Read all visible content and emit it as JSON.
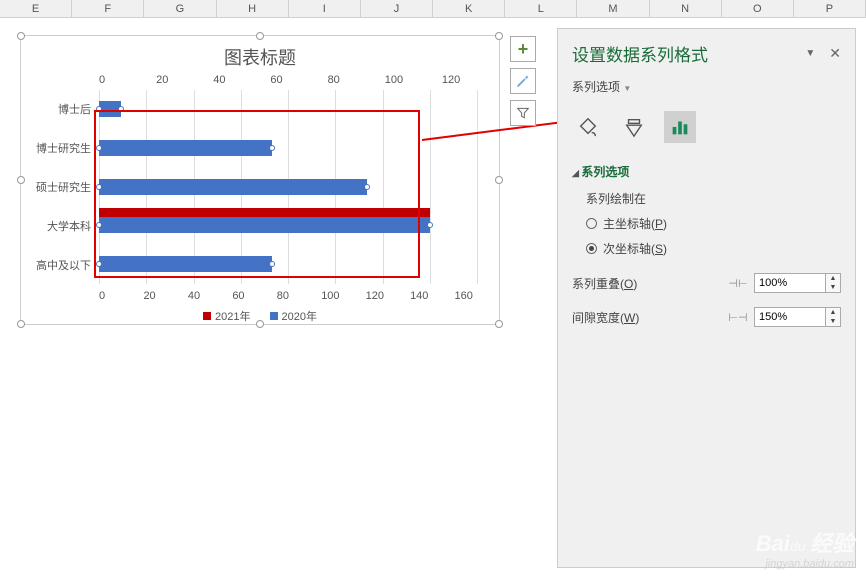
{
  "columns": [
    "E",
    "F",
    "G",
    "H",
    "I",
    "J",
    "K",
    "L",
    "M",
    "N",
    "O",
    "P"
  ],
  "chart": {
    "title": "图表标题",
    "legend_2021": "2021年",
    "legend_2020": "2020年"
  },
  "chart_data": {
    "type": "bar",
    "orientation": "horizontal",
    "categories": [
      "博士后",
      "博士研究生",
      "硕士研究生",
      "大学本科",
      "高中及以下"
    ],
    "series": [
      {
        "name": "2021年",
        "values": [
          null,
          null,
          null,
          140,
          null
        ],
        "axis": "primary",
        "color": "#c00000"
      },
      {
        "name": "2020年",
        "values": [
          7,
          55,
          85,
          105,
          55
        ],
        "axis": "secondary",
        "color": "#4472c4"
      }
    ],
    "primary_axis": {
      "position": "bottom",
      "min": 0,
      "max": 160,
      "step": 20,
      "ticks": [
        "0",
        "20",
        "40",
        "60",
        "80",
        "100",
        "120",
        "140",
        "160"
      ]
    },
    "secondary_axis": {
      "position": "top",
      "min": 0,
      "max": 120,
      "step": 20,
      "ticks": [
        "0",
        "20",
        "40",
        "60",
        "80",
        "100",
        "120"
      ]
    }
  },
  "side_tools": {
    "plus": "+",
    "brush": "brush",
    "filter": "filter"
  },
  "pane": {
    "title": "设置数据系列格式",
    "dropdown": "系列选项",
    "section": "系列选项",
    "plot_on": "系列绘制在",
    "radio_primary": "主坐标轴(",
    "radio_primary_u": "P",
    "radio_primary_end": ")",
    "radio_secondary": "次坐标轴(",
    "radio_secondary_u": "S",
    "radio_secondary_end": ")",
    "overlap_label": "系列重叠(",
    "overlap_u": "O",
    "overlap_end": ")",
    "overlap_value": "100%",
    "gap_label": "间隙宽度(",
    "gap_u": "W",
    "gap_end": ")",
    "gap_value": "150%"
  },
  "watermark": {
    "big": "Bai",
    "big2": "经验",
    "small": "jingyan.baidu.com"
  }
}
